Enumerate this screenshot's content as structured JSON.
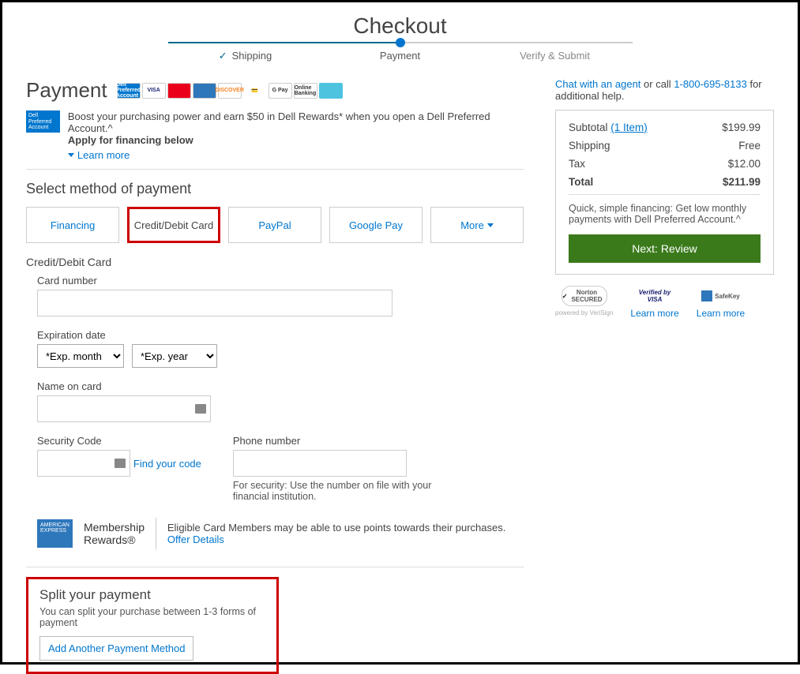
{
  "title": "Checkout",
  "steps": {
    "shipping": "Shipping",
    "payment": "Payment",
    "verify": "Verify & Submit"
  },
  "payment_header": "Payment",
  "card_brands": {
    "dpa": "Dell Preferred Account",
    "visa": "VISA",
    "mc": "mastercard",
    "amex": "AMEX",
    "discover": "DISCOVER",
    "paypal": "PayPal",
    "gpay": "G Pay",
    "online_banking": "Online Banking",
    "gift": "Gift Card"
  },
  "promo": {
    "badge": "Dell Preferred Account",
    "line1": "Boost your purchasing power and earn $50 in Dell Rewards* when you open a Dell Preferred Account.^",
    "line2": "Apply for financing below",
    "learn_more": "Learn more"
  },
  "select_method_title": "Select method of payment",
  "methods": {
    "financing": "Financing",
    "card": "Credit/Debit Card",
    "paypal": "PayPal",
    "gpay": "Google Pay",
    "more": "More"
  },
  "form": {
    "section_title": "Credit/Debit Card",
    "card_number_label": "Card number",
    "expiration_label": "Expiration date",
    "exp_month_placeholder": "*Exp. month",
    "exp_year_placeholder": "*Exp. year",
    "name_label": "Name on card",
    "security_label": "Security Code",
    "find_code": "Find your code",
    "phone_label": "Phone number",
    "phone_help": "For security: Use the number on file with your financial institution."
  },
  "amex": {
    "badge": "AMERICAN EXPRESS",
    "title1": "Membership",
    "title2": "Rewards®",
    "desc_prefix": "Eligible Card Members may be able to use points towards their purchases. ",
    "offer_link": "Offer Details"
  },
  "split": {
    "title": "Split your payment",
    "desc": "You can split your purchase between 1-3 forms of payment",
    "button": "Add Another Payment Method"
  },
  "help": {
    "chat": "Chat with an agent",
    "or_call": " or call ",
    "phone": "1-800-695-8133",
    "suffix": " for additional help."
  },
  "summary": {
    "subtotal_label": "Subtotal ",
    "item_count": "(1 Item)",
    "subtotal_value": "$199.99",
    "shipping_label": "Shipping",
    "shipping_value": "Free",
    "tax_label": "Tax",
    "tax_value": "$12.00",
    "total_label": "Total",
    "total_value": "$211.99",
    "financing_note": "Quick, simple financing: Get low monthly payments with Dell Preferred Account.^",
    "review_button": "Next: Review"
  },
  "trust": {
    "norton": "Norton SECURED",
    "norton_sub": "powered by VeriSign",
    "visa": "Verified by VISA",
    "safekey": "SafeKey",
    "learn_more": "Learn more"
  }
}
